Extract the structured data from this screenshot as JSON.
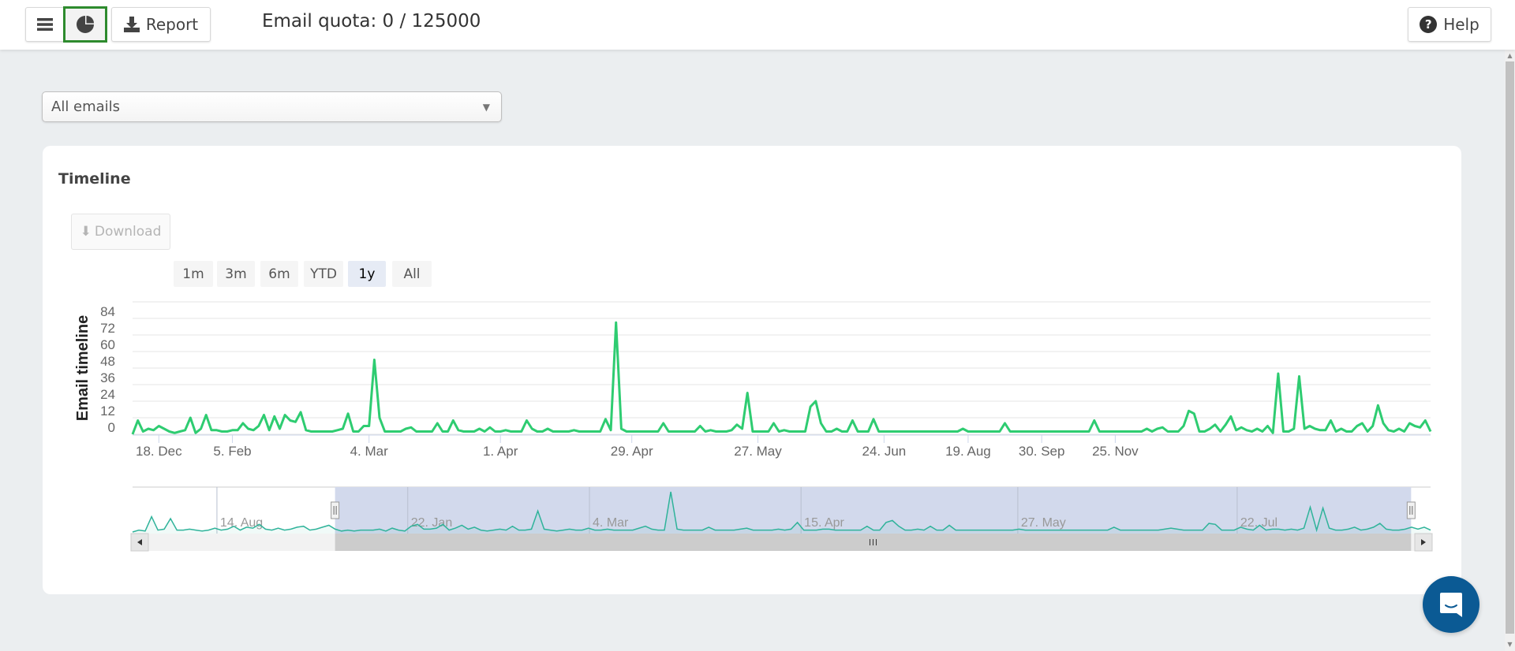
{
  "header": {
    "menu_icon": "hamburger-menu-icon",
    "chart_icon": "pie-chart-icon",
    "report_label": "Report",
    "report_icon": "download-icon",
    "quota_text": "Email quota: 0 / 125000",
    "help_label": "Help",
    "help_icon": "question-circle-icon"
  },
  "filter": {
    "selected": "All emails",
    "arrow": "▼"
  },
  "timeline": {
    "title": "Timeline",
    "download_label": "Download",
    "download_icon": "⬇",
    "ranges": [
      {
        "label": "1m",
        "active": false
      },
      {
        "label": "3m",
        "active": false
      },
      {
        "label": "6m",
        "active": false
      },
      {
        "label": "YTD",
        "active": false
      },
      {
        "label": "1y",
        "active": true
      },
      {
        "label": "All",
        "active": false
      }
    ]
  },
  "colors": {
    "series": "#2ecc71",
    "navigator_series": "#2fb39a",
    "navigator_mask": "#d2d9ec",
    "chat_button": "#0b5a94",
    "active_outline": "#2e8b2e"
  },
  "chart_data": {
    "type": "line",
    "title": "Timeline",
    "ylabel": "Email timeline",
    "xlabel": "",
    "ylim": [
      0,
      96
    ],
    "yticks": [
      0,
      12,
      24,
      36,
      48,
      60,
      72,
      84
    ],
    "grid": true,
    "legend": "none",
    "xticks": [
      {
        "label": "18. Dec",
        "index": 5
      },
      {
        "label": "5. Feb",
        "index": 19
      },
      {
        "label": "4. Mar",
        "index": 45
      },
      {
        "label": "1. Apr",
        "index": 70
      },
      {
        "label": "29. Apr",
        "index": 95
      },
      {
        "label": "27. May",
        "index": 119
      },
      {
        "label": "24. Jun",
        "index": 143
      },
      {
        "label": "19. Aug",
        "index": 159
      },
      {
        "label": "30. Sep",
        "index": 173
      },
      {
        "label": "25. Nov",
        "index": 187
      }
    ],
    "series": [
      {
        "name": "Email timeline",
        "values": [
          0,
          10,
          2,
          4,
          3,
          6,
          4,
          2,
          1,
          2,
          3,
          12,
          1,
          4,
          14,
          3,
          3,
          2,
          2,
          3,
          3,
          8,
          4,
          3,
          6,
          14,
          3,
          13,
          4,
          14,
          10,
          9,
          16,
          3,
          2,
          2,
          2,
          2,
          2,
          3,
          4,
          15,
          2,
          2,
          6,
          6,
          54,
          12,
          2,
          2,
          2,
          2,
          4,
          5,
          2,
          2,
          2,
          2,
          8,
          2,
          2,
          10,
          3,
          2,
          2,
          2,
          4,
          2,
          5,
          2,
          2,
          3,
          2,
          2,
          2,
          10,
          4,
          2,
          2,
          4,
          2,
          2,
          2,
          2,
          3,
          2,
          2,
          2,
          2,
          2,
          11,
          3,
          81,
          4,
          2,
          2,
          2,
          2,
          2,
          2,
          2,
          8,
          2,
          2,
          2,
          2,
          2,
          2,
          6,
          2,
          3,
          2,
          2,
          2,
          3,
          7,
          4,
          30,
          2,
          2,
          2,
          2,
          8,
          2,
          3,
          2,
          2,
          2,
          2,
          20,
          24,
          8,
          2,
          2,
          4,
          2,
          2,
          10,
          2,
          2,
          2,
          11,
          2,
          2,
          2,
          2,
          2,
          2,
          2,
          2,
          2,
          2,
          2,
          2,
          2,
          2,
          2,
          2,
          4,
          2,
          2,
          2,
          2,
          2,
          2,
          2,
          8,
          2,
          2,
          2,
          2,
          2,
          2,
          2,
          2,
          2,
          2,
          2,
          2,
          2,
          2,
          2,
          2,
          10,
          2,
          2,
          2,
          2,
          2,
          2,
          2,
          2,
          2,
          4,
          2,
          4,
          5,
          2,
          2,
          2,
          6,
          17,
          15,
          2,
          2,
          4,
          7,
          2,
          7,
          13,
          3,
          5,
          3,
          2,
          4,
          2,
          6,
          1,
          44,
          2,
          2,
          4,
          42,
          4,
          6,
          4,
          3,
          3,
          10,
          2,
          4,
          2,
          2,
          6,
          8,
          2,
          6,
          21,
          8,
          3,
          2,
          4,
          2,
          8,
          6,
          5,
          10,
          2
        ]
      }
    ],
    "navigator": {
      "xticks": [
        {
          "label": "14. Aug",
          "position": 0.065
        },
        {
          "label": "22. Jan",
          "position": 0.212
        },
        {
          "label": "4. Mar",
          "position": 0.352
        },
        {
          "label": "15. Apr",
          "position": 0.515
        },
        {
          "label": "27. May",
          "position": 0.682
        },
        {
          "label": "22. Jul",
          "position": 0.851
        }
      ],
      "selected_range": [
        0.156,
        0.985
      ],
      "values": [
        0,
        2,
        1,
        16,
        2,
        3,
        14,
        2,
        2,
        3,
        2,
        1,
        2,
        4,
        2,
        3,
        6,
        2,
        5,
        4,
        8,
        3,
        2,
        4,
        2,
        3,
        5,
        6,
        2,
        3,
        5,
        7,
        3,
        1,
        2,
        1,
        2,
        2,
        2,
        3,
        1,
        4,
        2,
        1,
        6,
        8,
        3,
        3,
        4,
        8,
        2,
        4,
        7,
        3,
        5,
        2,
        1,
        2,
        3,
        2,
        6,
        2,
        2,
        3,
        22,
        3,
        2,
        1,
        2,
        3,
        2,
        2,
        4,
        2,
        2,
        3,
        2,
        2,
        2,
        2,
        4,
        6,
        3,
        2,
        2,
        42,
        3,
        2,
        2,
        2,
        2,
        5,
        2,
        2,
        2,
        2,
        3,
        4,
        2,
        2,
        2,
        2,
        3,
        2,
        3,
        10,
        2,
        2,
        2,
        3,
        3,
        2,
        2,
        2,
        2,
        2,
        6,
        2,
        2,
        10,
        12,
        6,
        2,
        2,
        3,
        2,
        6,
        2,
        2,
        7,
        2,
        2,
        2,
        2,
        2,
        2,
        2,
        2,
        2,
        2,
        3,
        2,
        2,
        2,
        2,
        2,
        2,
        2,
        2,
        2,
        2,
        2,
        2,
        2,
        2,
        5,
        2,
        2,
        2,
        2,
        2,
        2,
        2,
        3,
        4,
        3,
        2,
        2,
        2,
        2,
        9,
        8,
        2,
        2,
        2,
        5,
        3,
        2,
        7,
        2,
        3,
        3,
        2,
        3,
        2,
        4,
        26,
        2,
        25,
        4,
        2,
        2,
        3,
        5,
        2,
        3,
        5,
        9,
        3,
        2,
        2,
        3,
        5,
        3,
        5,
        2
      ]
    }
  }
}
